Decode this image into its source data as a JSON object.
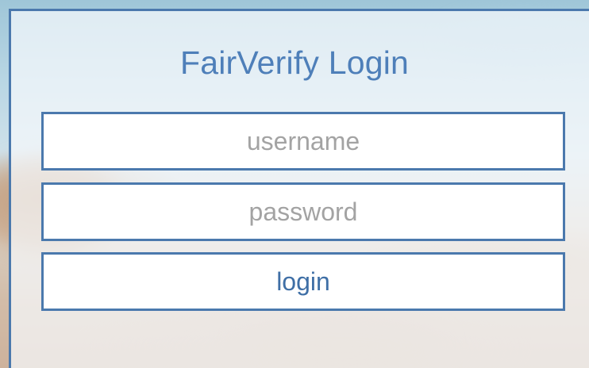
{
  "login": {
    "title": "FairVerify Login",
    "username": {
      "placeholder": "username",
      "value": ""
    },
    "password": {
      "placeholder": "password",
      "value": ""
    },
    "submit_label": "login"
  },
  "colors": {
    "accent": "#4b79ad",
    "title": "#4e7fb9",
    "placeholder": "#a3a3a3",
    "field_background": "#ffffff"
  }
}
